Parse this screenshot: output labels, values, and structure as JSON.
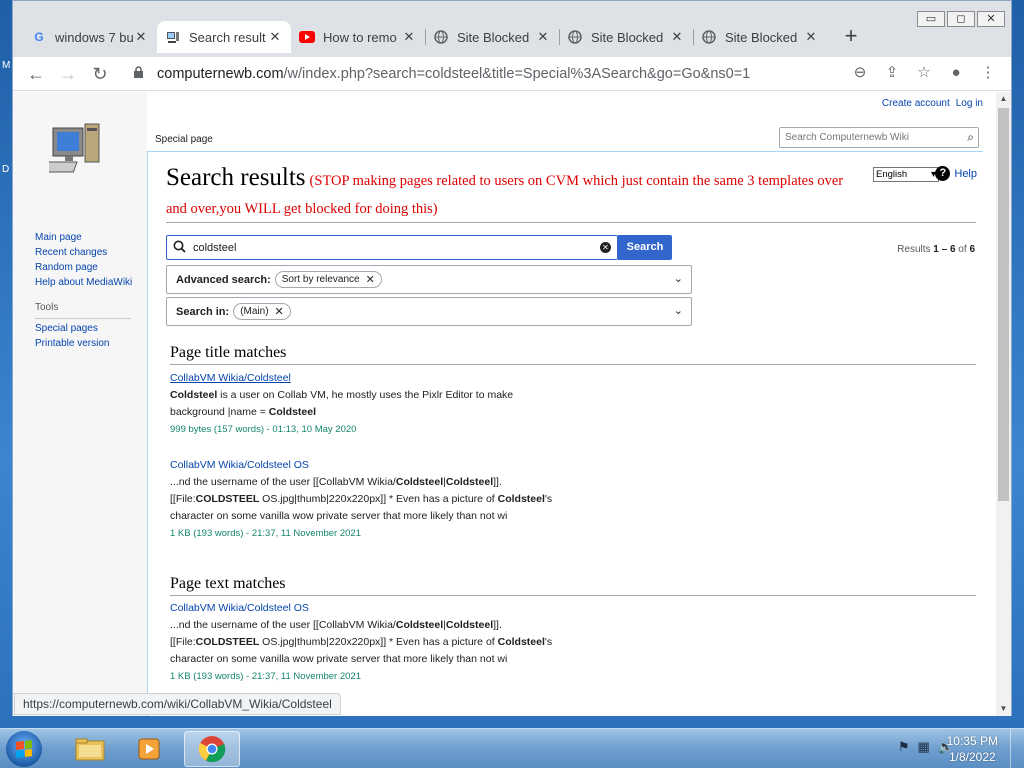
{
  "browser": {
    "tabs": [
      {
        "title": "windows 7 bu",
        "favicon": "google-icon",
        "active": false
      },
      {
        "title": "Search result",
        "favicon": "computer-favicon-icon",
        "active": true
      },
      {
        "title": "How to remo",
        "favicon": "youtube-icon",
        "active": false
      },
      {
        "title": "Site Blocked",
        "favicon": "globe-icon",
        "active": false
      },
      {
        "title": "Site Blocked",
        "favicon": "globe-icon",
        "active": false
      },
      {
        "title": "Site Blocked",
        "favicon": "globe-icon",
        "active": false
      }
    ],
    "new_tab_label": "+",
    "url_host": "computernewb.com",
    "url_path": "/w/index.php?search=coldsteel&title=Special%3ASearch&go=Go&ns0=1",
    "status_url": "https://computernewb.com/wiki/CollabVM_Wikia/Coldsteel"
  },
  "wiki": {
    "personal": {
      "create_account": "Create account",
      "log_in": "Log in"
    },
    "content_tab": "Special page",
    "search_placeholder": "Search Computernewb Wiki",
    "nav": {
      "main_page": "Main page",
      "recent_changes": "Recent changes",
      "random_page": "Random page",
      "help_about": "Help about MediaWiki",
      "tools_heading": "Tools",
      "special_pages": "Special pages",
      "printable_version": "Printable version"
    },
    "heading": "Search results",
    "warning": "(STOP making pages related to users on CVM which just contain the same 3 templates over and over,you WILL get blocked for doing this)",
    "language": "English",
    "help": "Help",
    "query": "coldsteel",
    "search_button": "Search",
    "results_count_prefix": "Results ",
    "results_count_range": "1 – 6",
    "results_count_mid": " of ",
    "results_count_total": "6",
    "advanced_label": "Advanced search:",
    "advanced_chip": "Sort by relevance",
    "search_in_label": "Search in:",
    "search_in_chip": "(Main)",
    "section_title_matches": "Page title matches",
    "section_text_matches": "Page text matches",
    "result1": {
      "title": "CollabVM Wikia/Coldsteel",
      "snippet_b1": "Coldsteel",
      "snippet_t1": " is a user on Collab VM, he mostly uses the Pixlr Editor to make",
      "snippet_t2": "background |name = ",
      "snippet_b2": "Coldsteel",
      "meta": "999 bytes (157 words) - 01:13, 10 May 2020"
    },
    "result2": {
      "title": "CollabVM Wikia/Coldsteel OS",
      "l1a": "...nd the username of the user [[CollabVM Wikia/",
      "l1b": "Coldsteel",
      "l1c": "|",
      "l1d": "Coldsteel",
      "l1e": "]].",
      "l2a": "[[File:",
      "l2b": "COLDSTEEL",
      "l2c": " OS.jpg|thumb|220x220px]] * Even has a picture of ",
      "l2d": "Coldsteel",
      "l2e": "'s",
      "l3": "character on some vanilla wow private server that more likely than not wi",
      "meta": "1 KB (193 words) - 21:37, 11 November 2021"
    },
    "result3": {
      "title": "CollabVM Wikia/Coldsteel OS",
      "l1a": "...nd the username of the user [[CollabVM Wikia/",
      "l1b": "Coldsteel",
      "l1c": "|",
      "l1d": "Coldsteel",
      "l1e": "]].",
      "l2a": "[[File:",
      "l2b": "COLDSTEEL",
      "l2c": " OS.jpg|thumb|220x220px]] * Even has a picture of ",
      "l2d": "Coldsteel",
      "l2e": "'s",
      "l3": "character on some vanilla wow private server that more likely than not wi",
      "meta": "1 KB (193 words) - 21:37, 11 November 2021"
    }
  },
  "taskbar": {
    "time": "10:35 PM",
    "date": "1/8/2022"
  },
  "colors": {
    "link": "#0645ad",
    "warning": "#dd0000",
    "accent": "#3366cc",
    "meta": "#14866d"
  }
}
